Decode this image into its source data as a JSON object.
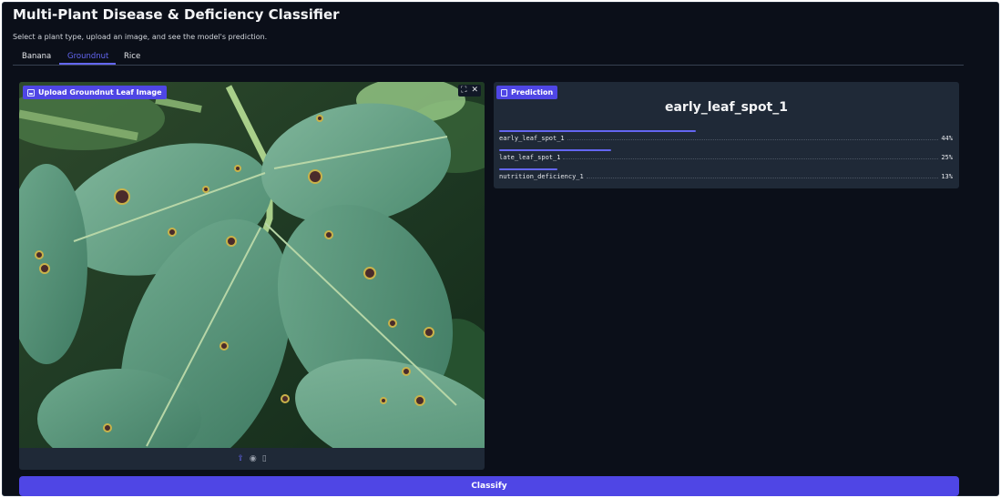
{
  "app": {
    "title": "Multi-Plant Disease & Deficiency Classifier",
    "subtitle": "Select a plant type, upload an image, and see the model's prediction."
  },
  "tabs": [
    {
      "label": "Banana",
      "active": false
    },
    {
      "label": "Groundnut",
      "active": true
    },
    {
      "label": "Rice",
      "active": false
    }
  ],
  "upload": {
    "label": "Upload Groundnut Leaf Image",
    "icons": [
      "fullscreen-icon",
      "close-icon"
    ],
    "toolbar_icons": [
      "upload-icon",
      "webcam-icon",
      "clipboard-icon"
    ]
  },
  "prediction": {
    "label": "Prediction",
    "top_label": "early_leaf_spot_1",
    "confidences": [
      {
        "label": "early_leaf_spot_1",
        "value": 0.44,
        "text": "44%"
      },
      {
        "label": "late_leaf_spot_1",
        "value": 0.25,
        "text": "25%"
      },
      {
        "label": "nutrition_deficiency_1",
        "value": 0.13,
        "text": "13%"
      }
    ]
  },
  "classify_button": "Classify",
  "colors": {
    "accent": "#6366f1",
    "button": "#4f46e5",
    "background": "#0b0f19",
    "panel": "#1f2937"
  }
}
